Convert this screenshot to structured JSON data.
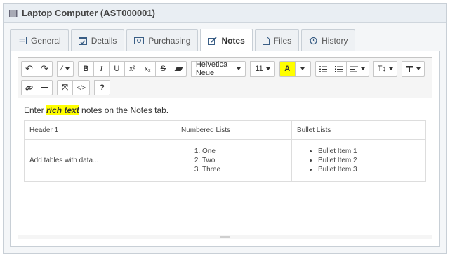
{
  "header": {
    "title": "Laptop Computer (AST000001)",
    "icon": "barcode-icon"
  },
  "tabs": [
    {
      "label": "General",
      "icon": "list-icon",
      "active": false
    },
    {
      "label": "Details",
      "icon": "calendar-check-icon",
      "active": false
    },
    {
      "label": "Purchasing",
      "icon": "money-icon",
      "active": false
    },
    {
      "label": "Notes",
      "icon": "pencil-square-icon",
      "active": true
    },
    {
      "label": "Files",
      "icon": "file-icon",
      "active": false
    },
    {
      "label": "History",
      "icon": "history-icon",
      "active": false
    }
  ],
  "toolbar": {
    "font_family": "Helvetica Neue",
    "font_size": "11",
    "bold": "B",
    "italic": "I",
    "underline": "U",
    "superscript": "x²",
    "subscript": "x₂",
    "strikethrough": "S",
    "help": "?",
    "highlight_color": "#ffff00"
  },
  "editor": {
    "intro_prefix": "Enter ",
    "intro_highlight": "rich text",
    "intro_underline": "notes",
    "intro_suffix": " on the Notes tab.",
    "table": {
      "headers": [
        "Header 1",
        "Numbered Lists",
        "Bullet Lists"
      ],
      "cell_text": "Add tables with data...",
      "numbered": [
        "One",
        "Two",
        "Three"
      ],
      "bullets": [
        "Bullet Item 1",
        "Bullet Item 2",
        "Bullet Item 3"
      ]
    }
  }
}
